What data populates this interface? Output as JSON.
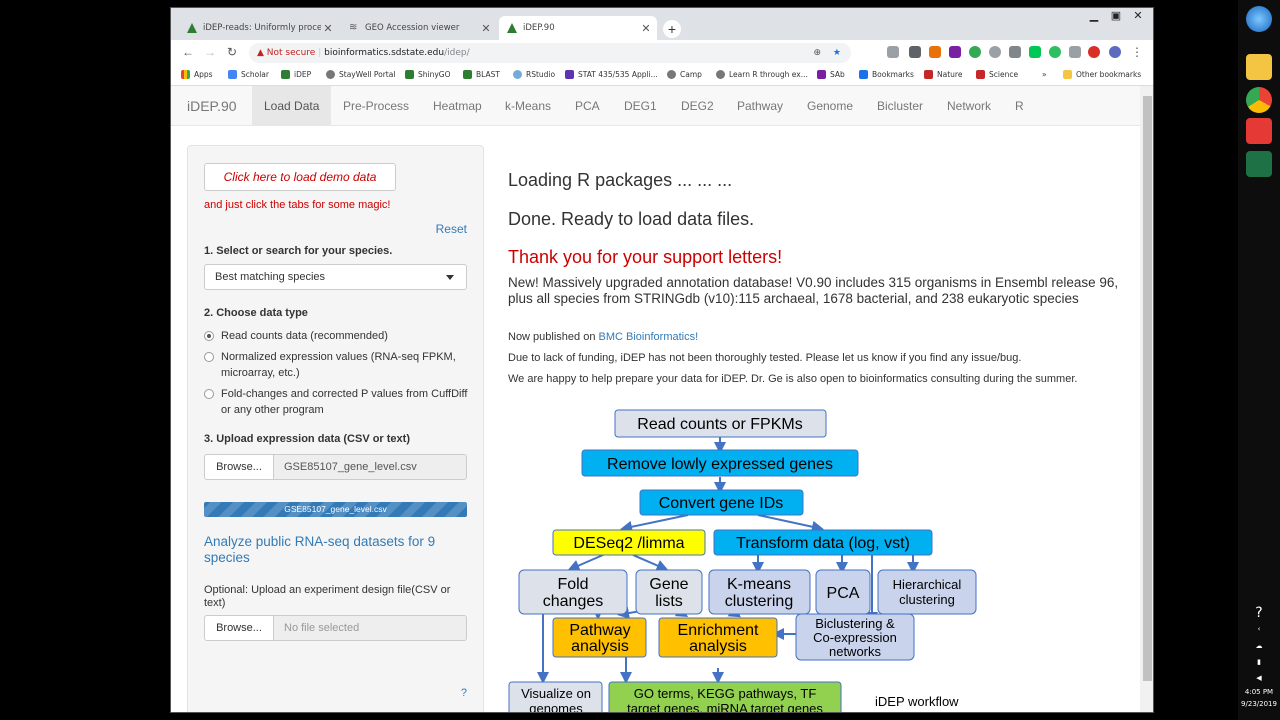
{
  "browser": {
    "tabs": [
      {
        "title": "iDEP-reads: Uniformly processed",
        "active": false
      },
      {
        "title": "GEO Accession viewer",
        "active": false
      },
      {
        "title": "iDEP.90",
        "active": true
      }
    ],
    "address": {
      "warning": "Not secure",
      "host": "bioinformatics.sdstate.edu",
      "path": "/idep/"
    },
    "bookmarks": [
      "Apps",
      "Scholar",
      "iDEP",
      "StayWell Portal",
      "ShinyGO",
      "BLAST",
      "RStudio",
      "STAT 435/535 Appli...",
      "Camp",
      "Learn R through ex...",
      "SAb",
      "Bookmarks",
      "Nature",
      "Science"
    ],
    "more_bookmarks": "»",
    "other_bookmarks": "Other bookmarks"
  },
  "navbar": {
    "brand": "iDEP.90",
    "items": [
      "Load Data",
      "Pre-Process",
      "Heatmap",
      "k-Means",
      "PCA",
      "DEG1",
      "DEG2",
      "Pathway",
      "Genome",
      "Bicluster",
      "Network",
      "R"
    ],
    "active": "Load Data"
  },
  "sidebar": {
    "demo_button": "Click here to load demo data",
    "magic_text": "and just click the tabs for some magic!",
    "reset": "Reset",
    "species_label": "1. Select or search for your species.",
    "species_value": "Best matching species",
    "datatype_label": "2. Choose data type",
    "datatype_options": [
      "Read counts data (recommended)",
      "Normalized expression values (RNA-seq FPKM, microarray, etc.)",
      "Fold-changes and corrected P values from CuffDiff or any other program"
    ],
    "datatype_selected": 0,
    "upload_label": "3. Upload expression data (CSV or text)",
    "browse": "Browse...",
    "uploaded_file": "GSE85107_gene_level.csv",
    "progress_text": "GSE85107_gene_level.csv",
    "progress": 1.0,
    "analyze_link": "Analyze public RNA-seq datasets for 9 species",
    "optional_label": "Optional: Upload an experiment design file(CSV or text)",
    "browse2": "Browse...",
    "no_file": "No file selected",
    "help": "?"
  },
  "main": {
    "loading": "Loading R packages ... ... ...",
    "done": "Done. Ready to load data files.",
    "thanks": "Thank you for your support letters!",
    "news": "New! Massively upgraded annotation database! V0.90 includes 315 organisms in Ensembl release 96, plus all species from STRINGdb (v10):115 archaeal, 1678 bacterial, and 238 eukaryotic species",
    "published_prefix": "Now published on",
    "published_link": "BMC Bioinformatics!",
    "funding": "Due to lack of funding, iDEP has not been thoroughly tested. Please let us know if you find any issue/bug.",
    "help_text": "We are happy to help prepare your data for iDEP. Dr. Ge is also open to bioinformatics consulting during the summer."
  },
  "workflow": {
    "read_counts": "Read counts or FPKMs",
    "remove": "Remove lowly expressed genes",
    "convert": "Convert gene IDs",
    "deseq": "DESeq2 /limma",
    "transform": "Transform data (log, vst)",
    "fold1": "Fold",
    "fold2": "changes",
    "gene1": "Gene",
    "gene2": "lists",
    "kmeans1": "K-means",
    "kmeans2": "clustering",
    "pca": "PCA",
    "hier1": "Hierarchical",
    "hier2": "clustering",
    "pathway1": "Pathway",
    "pathway2": "analysis",
    "enrich1": "Enrichment",
    "enrich2": "analysis",
    "bicl1": "Biclustering &",
    "bicl2": "Co-expression",
    "bicl3": "networks",
    "viz1": "Visualize on",
    "viz2": "genomes",
    "go1": "GO terms, KEGG pathways, TF",
    "go2": "target genes, miRNA target genes",
    "caption": "iDEP workflow"
  },
  "taskbar": {
    "time": "4:05 PM",
    "date": "9/23/2019"
  },
  "colors": {
    "blue_box": "#00b0f0",
    "yellow_box": "#ffff00",
    "orange_box": "#ffc000",
    "green_box": "#92d050",
    "grey_box": "#dde2ea",
    "lavender_box": "#c9d4ec",
    "arrow": "#4472c4"
  }
}
